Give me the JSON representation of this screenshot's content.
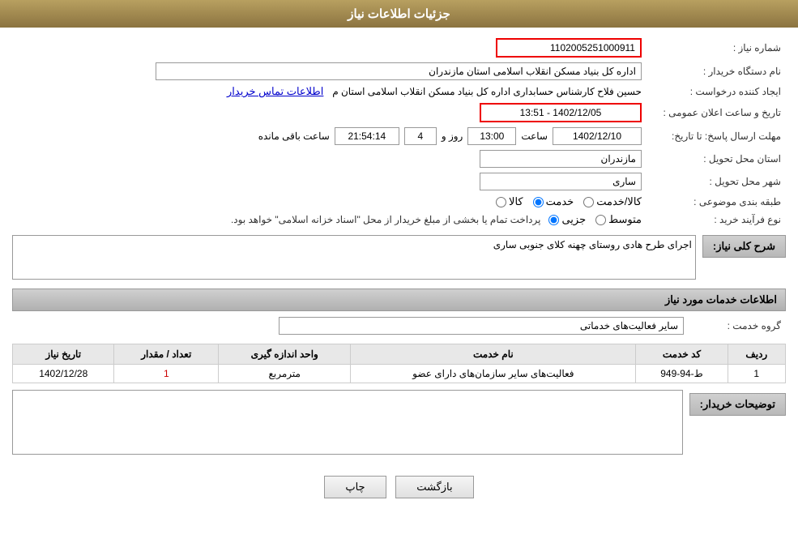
{
  "header": {
    "title": "جزئیات اطلاعات نیاز"
  },
  "fields": {
    "need_number_label": "شماره نیاز :",
    "need_number_value": "1102005251000911",
    "buyer_org_label": "نام دستگاه خریدار :",
    "buyer_org_value": "اداره کل بنیاد مسکن انقلاب اسلامی استان مازندران",
    "creator_label": "ایجاد کننده درخواست :",
    "creator_value": "حسین فلاح کارشناس حسابداری اداره کل بنیاد مسکن انقلاب اسلامی استان م",
    "creator_link": "اطلاعات تماس خریدار",
    "publish_date_label": "تاریخ و ساعت اعلان عمومی :",
    "publish_date_value": "1402/12/05 - 13:51",
    "reply_deadline_label": "مهلت ارسال پاسخ: تا تاریخ:",
    "reply_date": "1402/12/10",
    "reply_time": "13:00",
    "reply_days": "4",
    "reply_remaining": "21:54:14",
    "reply_remaining_label": "ساعت باقی مانده",
    "reply_days_label": "روز و",
    "reply_time_label": "ساعت",
    "province_label": "استان محل تحویل :",
    "province_value": "مازندران",
    "city_label": "شهر محل تحویل :",
    "city_value": "ساری",
    "category_label": "طبقه بندی موضوعی :",
    "category_options": [
      "کالا",
      "خدمت",
      "کالا/خدمت"
    ],
    "category_selected": "خدمت",
    "purchase_type_label": "نوع فرآیند خرید :",
    "purchase_type_options": [
      "جزیی",
      "متوسط"
    ],
    "purchase_type_note": "پرداخت تمام یا بخشی از مبلغ خریدار از محل \"اسناد خزانه اسلامی\" خواهد بود.",
    "need_desc_label": "شرح کلی نیاز:",
    "need_desc_value": "اجرای طرح هادی روستای چهنه کلای جنوبی ساری",
    "services_section_label": "اطلاعات خدمات مورد نیاز",
    "service_group_label": "گروه خدمت :",
    "service_group_value": "سایر فعالیت‌های خدماتی",
    "table": {
      "headers": [
        "ردیف",
        "کد خدمت",
        "نام خدمت",
        "واحد اندازه گیری",
        "تعداد / مقدار",
        "تاریخ نیاز"
      ],
      "rows": [
        {
          "row": "1",
          "code": "ط-94-949",
          "name": "فعالیت‌های سایر سازمان‌های دارای عضو",
          "unit": "مترمربع",
          "qty": "1",
          "date": "1402/12/28"
        }
      ]
    },
    "buyer_desc_label": "توضیحات خریدار:",
    "buyer_desc_value": ""
  },
  "buttons": {
    "print_label": "چاپ",
    "back_label": "بازگشت"
  }
}
